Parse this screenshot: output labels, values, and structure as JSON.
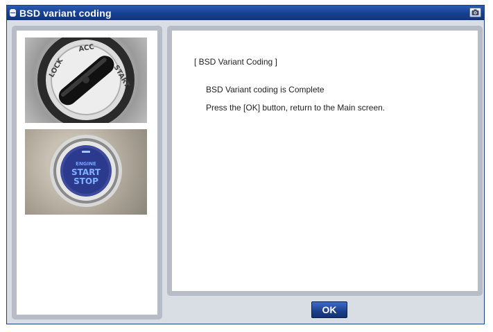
{
  "window": {
    "title": "BSD variant coding",
    "title_icon": "disc-icon",
    "capture_icon": "camera-icon"
  },
  "images": {
    "ignition_key": {
      "description_icon": "ignition-key-icon",
      "labels": [
        "LOCK",
        "ACC",
        "START"
      ]
    },
    "start_stop_button": {
      "description_icon": "start-stop-button-icon",
      "labels": [
        "ENGINE",
        "START",
        "STOP"
      ]
    }
  },
  "content": {
    "heading": "[ BSD Variant Coding ]",
    "line1": "BSD Variant coding is Complete",
    "line2": "Press the [OK] button, return to the Main screen."
  },
  "buttons": {
    "ok_label": "OK"
  },
  "colors": {
    "titlebar": "#163f8f",
    "panel_frame": "#b8bcc6",
    "ok_button": "#1b3f8c"
  }
}
